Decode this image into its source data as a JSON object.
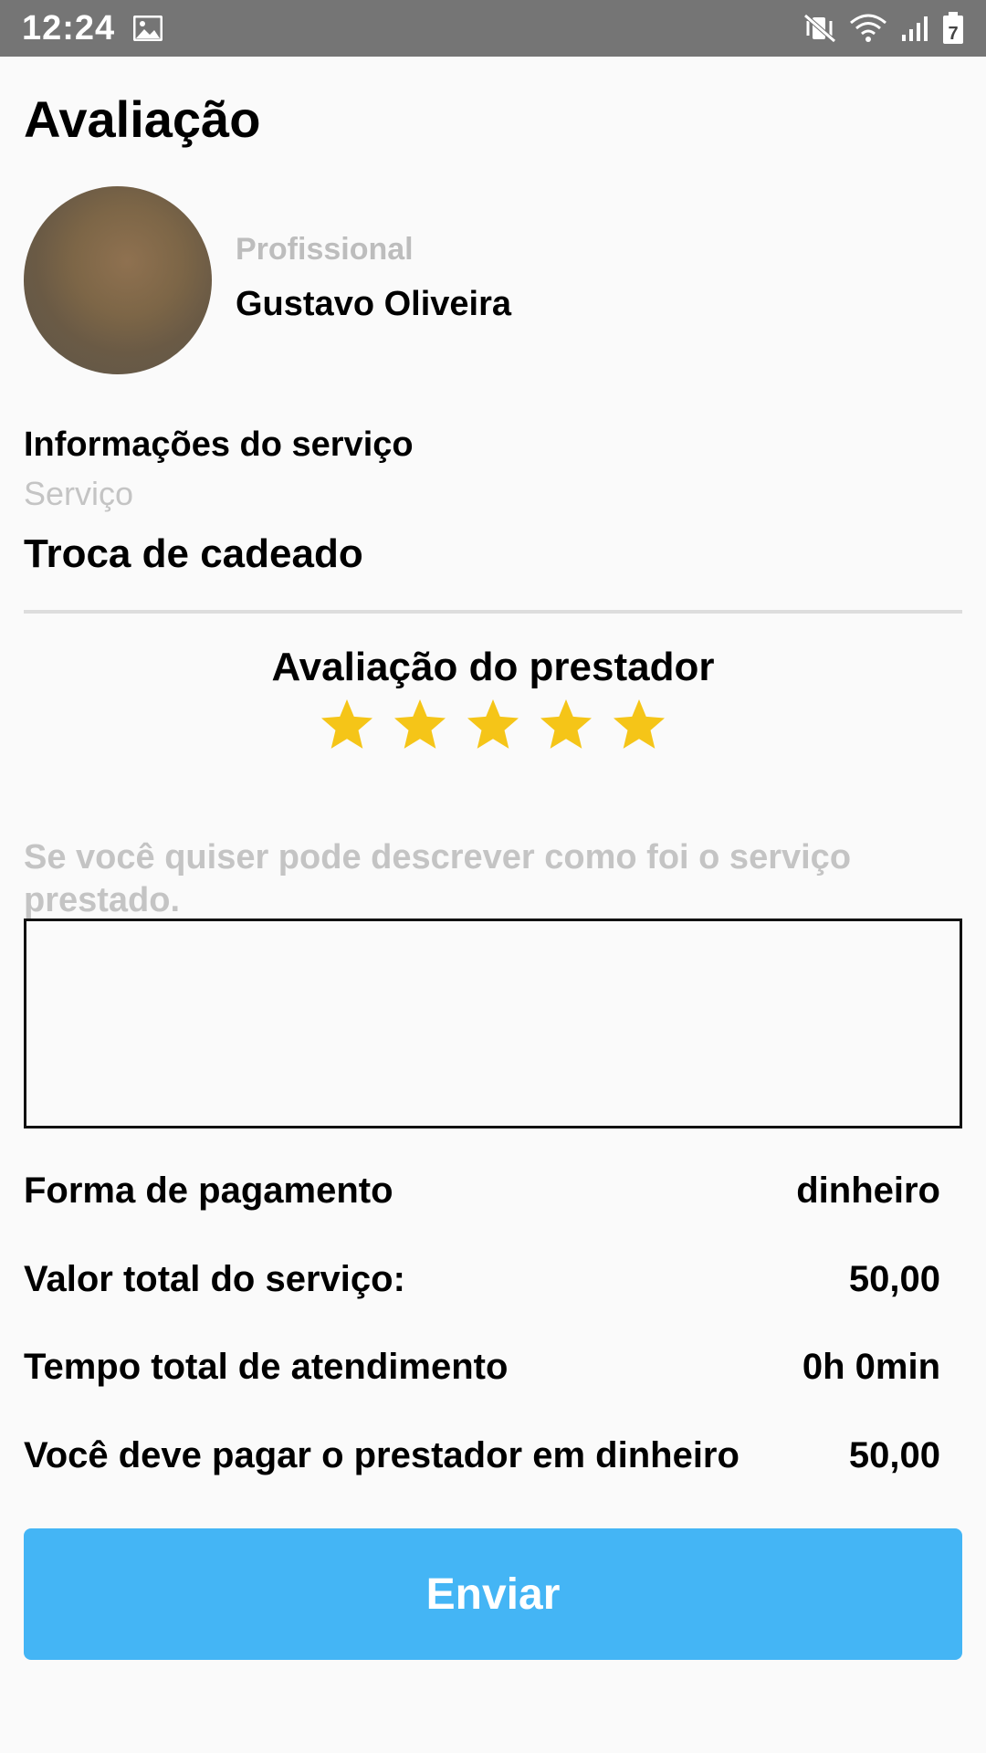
{
  "status_bar": {
    "time": "12:24",
    "battery_level": "7",
    "icons": [
      "image-icon",
      "vibrate-mute-icon",
      "wifi-icon",
      "signal-icon",
      "battery-icon"
    ]
  },
  "header": {
    "title": "Avaliação"
  },
  "professional": {
    "label": "Profissional",
    "name": "Gustavo Oliveira"
  },
  "service_info": {
    "title": "Informações do serviço",
    "service_label": "Serviço",
    "service_value": "Troca de cadeado"
  },
  "rating": {
    "title": "Avaliação do prestador",
    "value": 5,
    "max": 5,
    "star_color": "#f5c518"
  },
  "comment": {
    "hint": "Se você quiser pode descrever como foi o serviço prestado.",
    "value": ""
  },
  "summary": {
    "payment_method_label": "Forma de pagamento",
    "payment_method_value": "dinheiro",
    "total_value_label": "Valor total do serviço:",
    "total_value": "50,00",
    "total_time_label": "Tempo total de atendimento",
    "total_time_value": "0h 0min",
    "pay_label": "Você deve pagar o prestador em dinheiro",
    "pay_value": "50,00"
  },
  "actions": {
    "submit_label": "Enviar",
    "submit_color": "#44b5f5"
  }
}
